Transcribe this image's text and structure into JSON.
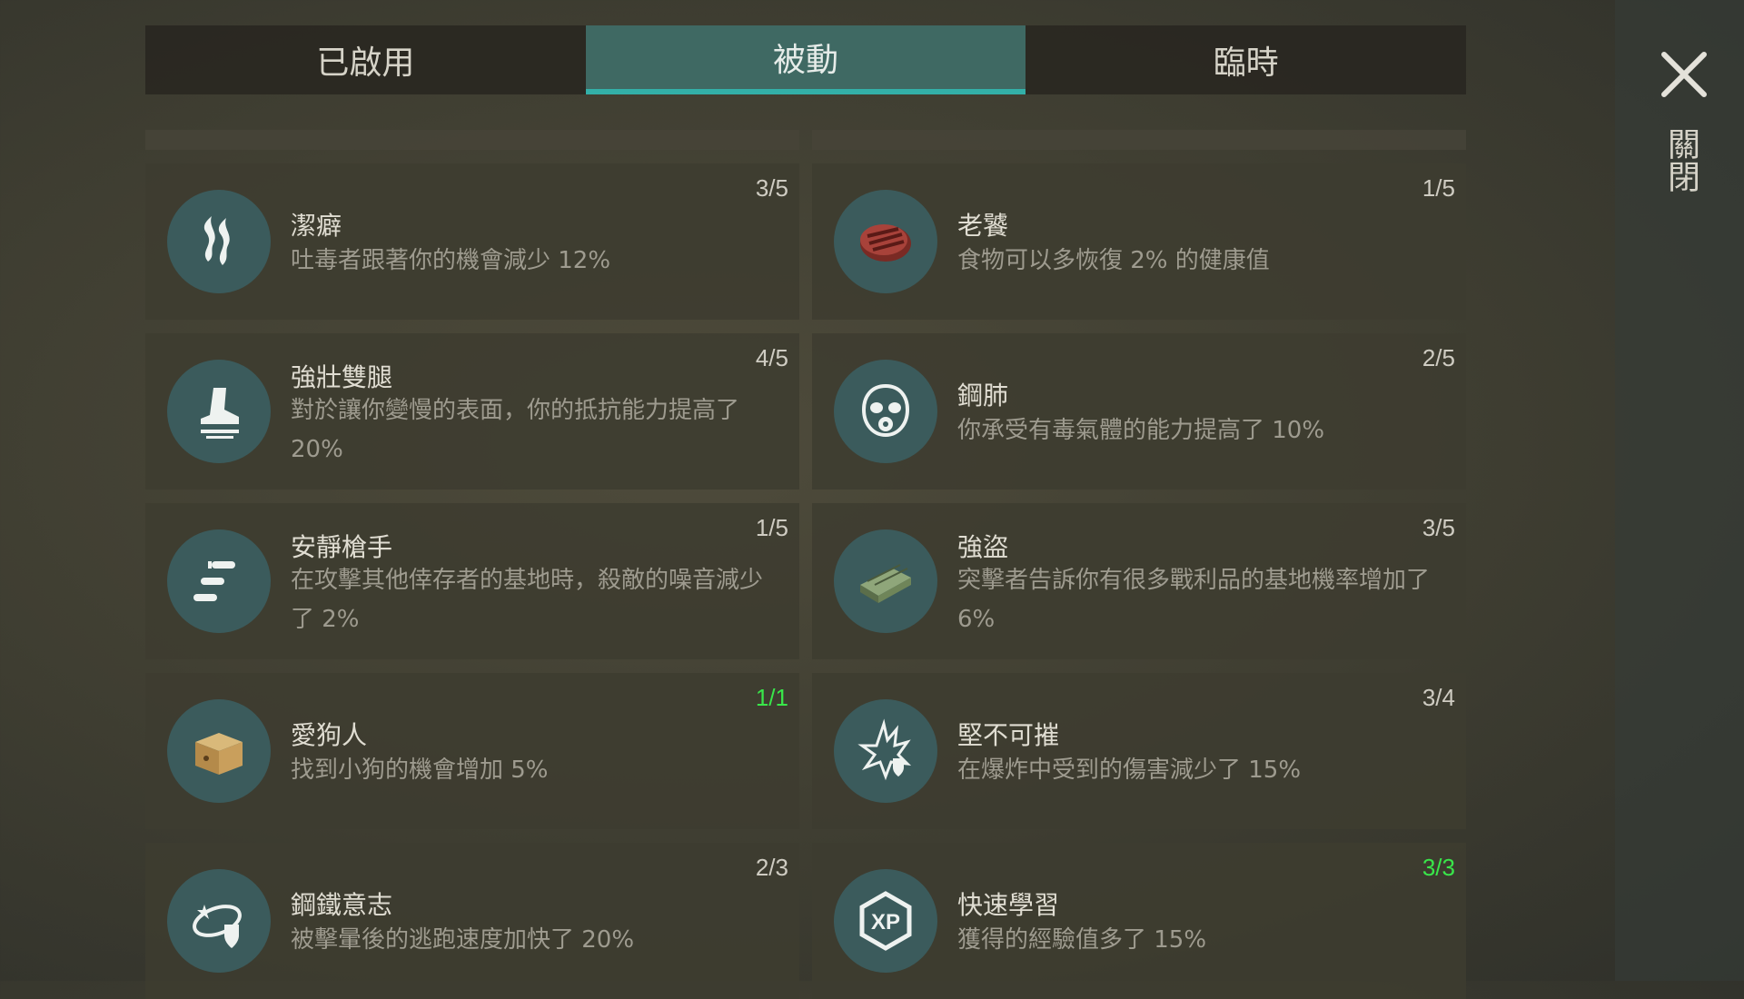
{
  "tabs": [
    {
      "label": "已啟用"
    },
    {
      "label": "被動"
    },
    {
      "label": "臨時"
    }
  ],
  "active_tab": "被動",
  "close_label": "關閉",
  "skills": [
    {
      "title": "潔癖",
      "desc": "吐毒者跟著你的機會減少 12%",
      "level": "3/5",
      "icon": "steam-icon"
    },
    {
      "title": "老饕",
      "desc": "食物可以多恢復 2% 的健康值",
      "level": "1/5",
      "icon": "steak-icon"
    },
    {
      "title": "強壯雙腿",
      "desc": "對於讓你變慢的表面，你的抵抗能力提高了 20%",
      "level": "4/5",
      "icon": "boot-icon"
    },
    {
      "title": "鋼肺",
      "desc": "你承受有毒氣體的能力提高了 10%",
      "level": "2/5",
      "icon": "gas-mask-icon"
    },
    {
      "title": "安靜槍手",
      "desc": "在攻擊其他倖存者的基地時，殺敵的噪音減少了 2%",
      "level": "1/5",
      "icon": "bullets-icon"
    },
    {
      "title": "強盜",
      "desc": "突擊者告訴你有很多戰利品的基地機率增加了 6%",
      "level": "3/5",
      "icon": "loot-crate-icon"
    },
    {
      "title": "愛狗人",
      "desc": "找到小狗的機會增加 5%",
      "level": "1/1",
      "icon": "dog-box-icon",
      "maxed": true
    },
    {
      "title": "堅不可摧",
      "desc": "在爆炸中受到的傷害減少了 15%",
      "level": "3/4",
      "icon": "explosion-shield-icon"
    },
    {
      "title": "鋼鐵意志",
      "desc": "被擊暈後的逃跑速度加快了 20%",
      "level": "2/3",
      "icon": "stun-shield-icon"
    },
    {
      "title": "快速學習",
      "desc": "獲得的經驗值多了 15%",
      "level": "3/3",
      "icon": "xp-icon",
      "maxed": true
    }
  ],
  "colors": {
    "accent": "#33b0a8",
    "max_level": "#39e64a",
    "icon_bg": "#3b5b5c"
  }
}
